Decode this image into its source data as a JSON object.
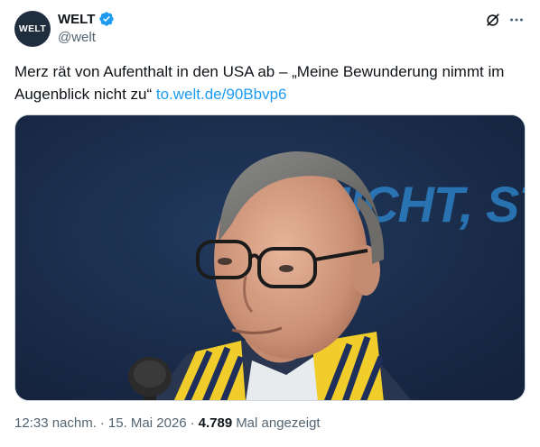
{
  "account": {
    "avatar_text": "WELT",
    "display_name": "WELT",
    "handle": "@welt",
    "verified": true,
    "verified_icon": "verified-badge-icon"
  },
  "actions": {
    "grok_icon": "grok-icon",
    "more_icon": "more-options-icon"
  },
  "tweet": {
    "text": "Merz rät von Aufenthalt in den USA ab – „Meine Bewunderung nimmt im Augenblick nicht zu“",
    "link": "to.welt.de/90Bbvp6"
  },
  "media": {
    "background_text": "NICHT, STEH A",
    "description": "photo"
  },
  "meta": {
    "time": "12:33 nachm.",
    "separator": "·",
    "date": "15. Mai 2026",
    "views_count": "4.789",
    "views_label": "Mal angezeigt"
  },
  "colors": {
    "link": "#1d9bf0",
    "text": "#0f1419",
    "secondary": "#536471",
    "verified": "#1d9bf0",
    "avatar": "#1f2d3d"
  }
}
